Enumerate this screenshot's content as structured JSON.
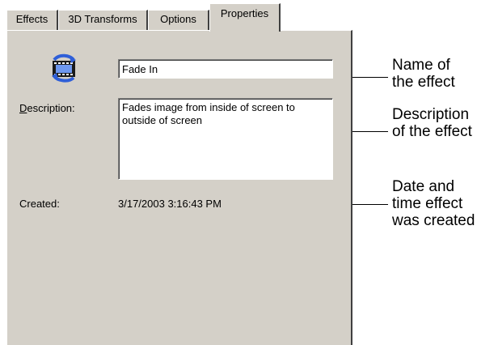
{
  "tabs": [
    {
      "label": "Effects",
      "active": false
    },
    {
      "label": "3D Transforms",
      "active": false
    },
    {
      "label": "Options",
      "active": false
    },
    {
      "label": "Properties",
      "active": true
    }
  ],
  "properties": {
    "icon": "effect-film-icon",
    "name_value": "Fade In",
    "description_label_accel": "D",
    "description_label_rest": "escription:",
    "description_value": "Fades image from inside of screen to outside of screen",
    "created_label": "Created:",
    "created_value": "3/17/2003 3:16:43 PM"
  },
  "annotations": {
    "name": {
      "line1": "Name of",
      "line2": "the effect"
    },
    "description": {
      "line1": "Description",
      "line2": "of the effect"
    },
    "created": {
      "line1": "Date and",
      "line2": "time effect",
      "line3": "was created"
    }
  },
  "colors": {
    "dialog_face": "#d4d0c8",
    "field_bg": "#ffffff",
    "highlight": "#ffffff",
    "shadow": "#404040",
    "icon_blue": "#2f5fd8",
    "icon_dark": "#1a1a1a"
  }
}
